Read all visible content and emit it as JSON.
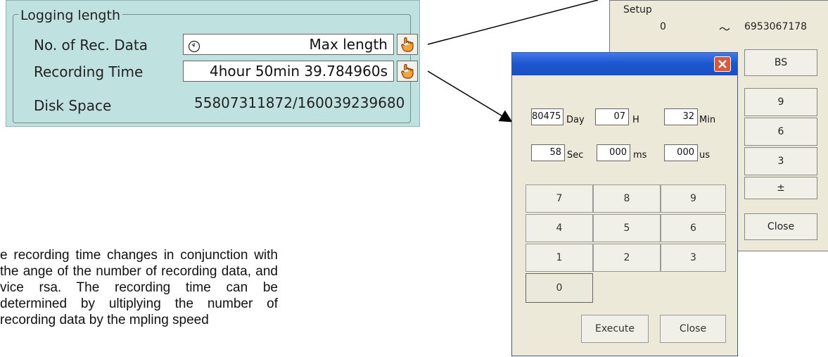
{
  "logging": {
    "title": "Logging length",
    "rec_data_label": "No. of Rec. Data",
    "rec_data_value": "Max length",
    "rec_time_label": "Recording Time",
    "rec_time_value": "4hour 50min 39.784960s",
    "disk_label": "Disk Space",
    "disk_value": "55807311872/160039239680"
  },
  "back_dialog": {
    "setup_label": "Setup",
    "range_min": "0",
    "range_sep": "～",
    "range_max": "6953067178",
    "bs_label": "BS",
    "keys": [
      "9",
      "6",
      "3",
      "±"
    ],
    "close_label": "Close"
  },
  "time_dialog": {
    "day_value": "80475",
    "day_unit": "Day",
    "h_value": "07",
    "h_unit": "H",
    "min_value": "32",
    "min_unit": "Min",
    "sec_value": "58",
    "sec_unit": "Sec",
    "ms_value": "000",
    "ms_unit": "ms",
    "us_value": "000",
    "us_unit": "us",
    "keys": [
      "7",
      "8",
      "9",
      "4",
      "5",
      "6",
      "1",
      "2",
      "3",
      "0"
    ],
    "execute_label": "Execute",
    "close_label": "Close"
  },
  "description": "e recording time changes in conjunction with the ange of the number of recording data, and vice rsa. The recording time can be determined by ultiplying the number of recording data by the mpling speed"
}
